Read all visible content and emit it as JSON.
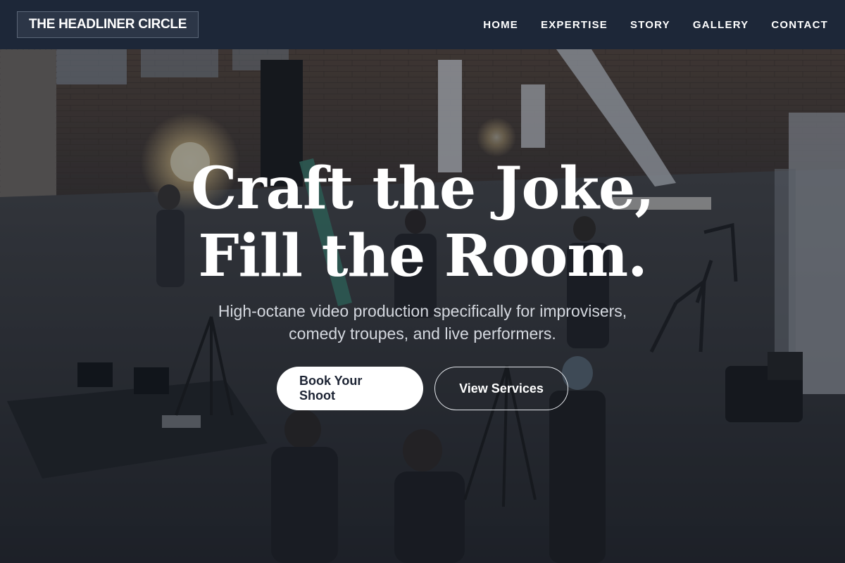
{
  "brand": {
    "logo_text": "THE HEADLINER CIRCLE"
  },
  "nav": {
    "items": [
      {
        "label": "HOME"
      },
      {
        "label": "EXPERTISE"
      },
      {
        "label": "STORY"
      },
      {
        "label": "GALLERY"
      },
      {
        "label": "CONTACT"
      }
    ]
  },
  "hero": {
    "headline_line1": "Craft the Joke,",
    "headline_line2": "Fill the Room.",
    "subhead_line1": "High-octane video production specifically for improvisers,",
    "subhead_line2": "comedy troupes, and live performers.",
    "primary_cta": "Book Your Shoot",
    "secondary_cta": "View Services"
  },
  "colors": {
    "header_bg": "#1d2738",
    "overlay": "#161c28",
    "primary_button_bg": "#ffffff",
    "primary_button_text": "#1c2333"
  }
}
